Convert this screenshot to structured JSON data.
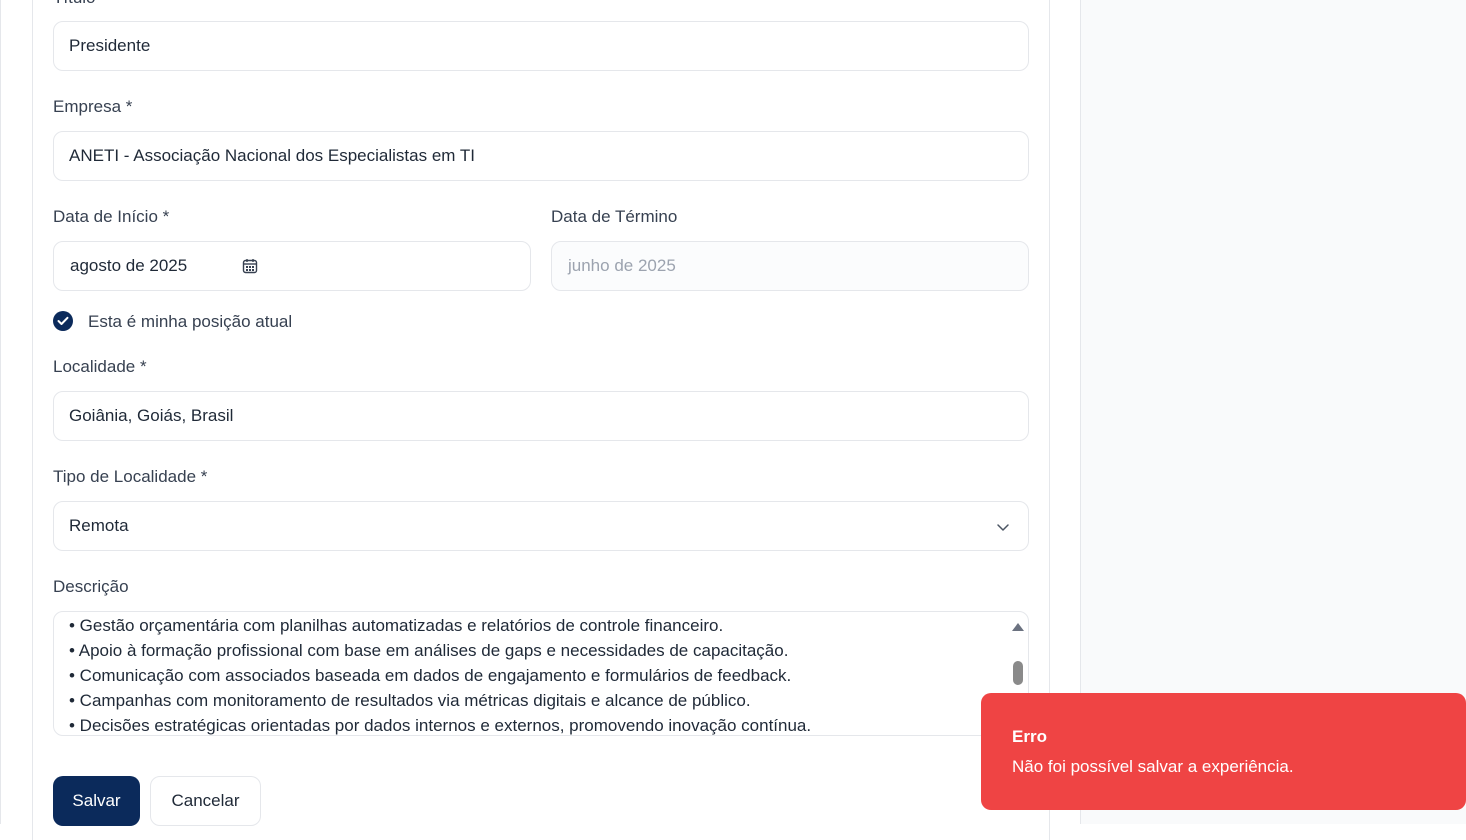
{
  "form": {
    "title_label": "Título",
    "title_value": "Presidente",
    "company_label": "Empresa *",
    "company_value": "ANETI - Associação Nacional dos Especialistas em TI",
    "start_date_label": "Data de Início *",
    "start_date_value": "agosto de 2025",
    "end_date_label": "Data de Término",
    "end_date_placeholder": "junho de 2025",
    "current_position_label": "Esta é minha posição atual",
    "current_position_checked": true,
    "location_label": "Localidade *",
    "location_value": "Goiânia, Goiás, Brasil",
    "location_type_label": "Tipo de Localidade *",
    "location_type_value": "Remota",
    "description_label": "Descrição",
    "description_lines": [
      "• Gestão orçamentária com planilhas automatizadas e relatórios de controle financeiro.",
      "• Apoio à formação profissional com base em análises de gaps e necessidades de capacitação.",
      "• Comunicação com associados baseada em dados de engajamento e formulários de feedback.",
      "• Campanhas com monitoramento de resultados via métricas digitais e alcance de público.",
      "• Decisões estratégicas orientadas por dados internos e externos, promovendo inovação contínua."
    ],
    "save_label": "Salvar",
    "cancel_label": "Cancelar"
  },
  "toast": {
    "title": "Erro",
    "message": "Não foi possível salvar a experiência.",
    "color": "#ef4444"
  },
  "colors": {
    "primary": "#0b2a5b",
    "border": "#e5e7eb"
  },
  "icons": {
    "calendar": "calendar-icon",
    "chevron": "chevron-down-icon",
    "check": "check-icon"
  }
}
